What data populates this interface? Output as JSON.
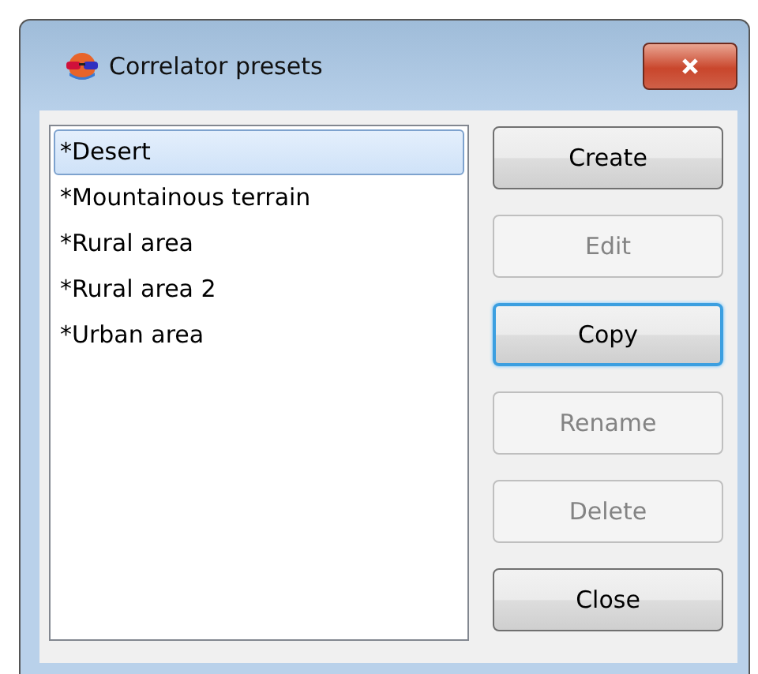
{
  "window": {
    "title": "Correlator presets"
  },
  "presets": [
    {
      "label": "*Desert",
      "selected": true
    },
    {
      "label": "*Mountainous terrain",
      "selected": false
    },
    {
      "label": "*Rural area",
      "selected": false
    },
    {
      "label": "*Rural area 2",
      "selected": false
    },
    {
      "label": "*Urban area",
      "selected": false
    }
  ],
  "buttons": [
    {
      "label": "Create",
      "disabled": false,
      "focused": false
    },
    {
      "label": "Edit",
      "disabled": true,
      "focused": false
    },
    {
      "label": "Copy",
      "disabled": false,
      "focused": true
    },
    {
      "label": "Rename",
      "disabled": true,
      "focused": false
    },
    {
      "label": "Delete",
      "disabled": true,
      "focused": false
    },
    {
      "label": "Close",
      "disabled": false,
      "focused": false
    }
  ]
}
